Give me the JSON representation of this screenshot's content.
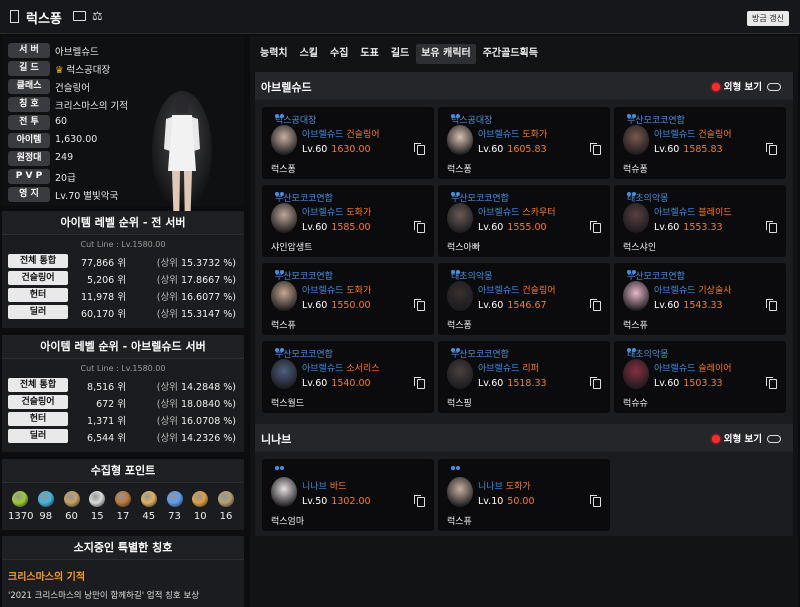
{
  "header": {
    "name": "럭스퐁",
    "refresh_label": "방금 갱신"
  },
  "profile": {
    "rows": [
      {
        "label": "서 버",
        "value": "아브렐슈드"
      },
      {
        "label": "길 드",
        "value": "럭스공대장"
      },
      {
        "label": "클래스",
        "value": "건슬링어"
      },
      {
        "label": "칭 호",
        "value": "크리스마스의 기적"
      },
      {
        "label": "전 투",
        "value": "60"
      },
      {
        "label": "아이템",
        "value": "1,630.00"
      },
      {
        "label": "원정대",
        "value": "249"
      },
      {
        "label": "P V P",
        "value": "20급"
      },
      {
        "label": "영 지",
        "value": "Lv.70 별빛악국"
      }
    ]
  },
  "rank_all": {
    "title": "아이템 레벨 순위 - 전 서버",
    "cutline": "Cut Line : Lv.1580.00",
    "rows": [
      {
        "label": "전체 통합",
        "rank": "77,866 위",
        "pct_prefix": "(상위",
        "pct": "15.3732 %)"
      },
      {
        "label": "건슬링어",
        "rank": "5,206 위",
        "pct_prefix": "(상위",
        "pct": "17.8667 %)"
      },
      {
        "label": "헌터",
        "rank": "11,978 위",
        "pct_prefix": "(상위",
        "pct": "16.6077 %)"
      },
      {
        "label": "딜러",
        "rank": "60,170 위",
        "pct_prefix": "(상위",
        "pct": "15.3147 %)"
      }
    ]
  },
  "rank_server": {
    "title": "아이템 레벨 순위 - 아브렐슈드 서버",
    "cutline": "Cut Line : Lv.1580.00",
    "rows": [
      {
        "label": "전체 통합",
        "rank": "8,516 위",
        "pct_prefix": "(상위",
        "pct": "14.2848 %)"
      },
      {
        "label": "건슬링어",
        "rank": "672 위",
        "pct_prefix": "(상위",
        "pct": "18.0840 %)"
      },
      {
        "label": "헌터",
        "rank": "1,371 위",
        "pct_prefix": "(상위",
        "pct": "16.0708 %)"
      },
      {
        "label": "딜러",
        "rank": "6,544 위",
        "pct_prefix": "(상위",
        "pct": "14.2326 %)"
      }
    ]
  },
  "collection": {
    "title": "수집형 포인트",
    "items": [
      {
        "icon": "mokoko-seed-icon",
        "value": "1370",
        "color": "#9acd32"
      },
      {
        "icon": "island-heart-icon",
        "value": "98",
        "color": "#3fb7e0"
      },
      {
        "icon": "great-painting-icon",
        "value": "60",
        "color": "#c8a060"
      },
      {
        "icon": "giant-heart-icon",
        "value": "15",
        "color": "#d9d9d9"
      },
      {
        "icon": "ignea-token-icon",
        "value": "17",
        "color": "#c0783a"
      },
      {
        "icon": "voyage-adventure-icon",
        "value": "45",
        "color": "#e0b060"
      },
      {
        "icon": "world-tree-leaf-icon",
        "value": "73",
        "color": "#5a9ef0"
      },
      {
        "icon": "orpheus-star-icon",
        "value": "10",
        "color": "#e0a040"
      },
      {
        "icon": "sea-bounty-icon",
        "value": "16",
        "color": "#b8a070"
      }
    ]
  },
  "titles_block": {
    "title": "소지중인 특별한 칭호",
    "name": "크리스마스의 기적",
    "desc": "'2021 크리스마스의 낭만이 함께하길' 업적 칭호 보상"
  },
  "tabs": [
    "능력치",
    "스킬",
    "수집",
    "도표",
    "길드",
    "보유 캐릭터",
    "주간골드획득"
  ],
  "look_label": "외형 보기",
  "servers": [
    {
      "name": "아브렐슈드",
      "cards": [
        {
          "guild": "럭스공대장",
          "server": "아브렐슈드",
          "class": "건슬링어",
          "lv": "Lv.60",
          "ilvl": "1630.00",
          "name": "럭스퐁",
          "face": "#c9b0a0"
        },
        {
          "guild": "럭스공대장",
          "server": "아브렐슈드",
          "class": "도화가",
          "lv": "Lv.60",
          "ilvl": "1605.83",
          "name": "럭스퐁",
          "face": "#d8c0b0"
        },
        {
          "guild": "부산모코코연합",
          "server": "아브렐슈드",
          "class": "건슬링어",
          "lv": "Lv.60",
          "ilvl": "1585.83",
          "name": "럭슈퐁",
          "face": "#7a5a50"
        },
        {
          "guild": "부산모코코연합",
          "server": "아브렐슈드",
          "class": "도화가",
          "lv": "Lv.60",
          "ilvl": "1585.00",
          "name": "샤인압생트",
          "face": "#c0a898"
        },
        {
          "guild": "부산모코코연합",
          "server": "아브렐슈드",
          "class": "스카우터",
          "lv": "Lv.60",
          "ilvl": "1555.00",
          "name": "럭스아빠",
          "face": "#6a5a55"
        },
        {
          "guild": "태초의악몽",
          "server": "아브렐슈드",
          "class": "블레이드",
          "lv": "Lv.60",
          "ilvl": "1553.33",
          "name": "럭스샤인",
          "face": "#5a4040"
        },
        {
          "guild": "부산모코코연합",
          "server": "아브렐슈드",
          "class": "도화가",
          "lv": "Lv.60",
          "ilvl": "1550.00",
          "name": "럭스퓨",
          "face": "#c8a890"
        },
        {
          "guild": "태초의악몽",
          "server": "아브렐슈드",
          "class": "건슬링어",
          "lv": "Lv.60",
          "ilvl": "1546.67",
          "name": "럭스퐁",
          "face": "#3a3030"
        },
        {
          "guild": "부산모코코연합",
          "server": "아브렐슈드",
          "class": "기상술사",
          "lv": "Lv.60",
          "ilvl": "1543.33",
          "name": "럭스퓨",
          "face": "#e8b8c8"
        },
        {
          "guild": "부산모코코연합",
          "server": "아브렐슈드",
          "class": "소서리스",
          "lv": "Lv.60",
          "ilvl": "1540.00",
          "name": "럭스월드",
          "face": "#506080"
        },
        {
          "guild": "부산모코코연합",
          "server": "아브렐슈드",
          "class": "리퍼",
          "lv": "Lv.60",
          "ilvl": "1518.33",
          "name": "럭스핑",
          "face": "#4a4040"
        },
        {
          "guild": "태초의악몽",
          "server": "아브렐슈드",
          "class": "슬레이어",
          "lv": "Lv.60",
          "ilvl": "1503.33",
          "name": "럭슈슈",
          "face": "#8a3040"
        }
      ]
    },
    {
      "name": "니나브",
      "cards": [
        {
          "guild": "-",
          "server": "니나브",
          "class": "바드",
          "lv": "Lv.50",
          "ilvl": "1302.00",
          "name": "럭스엄마",
          "face": "#e8e0e0"
        },
        {
          "guild": "-",
          "server": "니나브",
          "class": "도화가",
          "lv": "Lv.10",
          "ilvl": "50.00",
          "name": "럭스퓨",
          "face": "#c8b0a0"
        }
      ]
    }
  ]
}
